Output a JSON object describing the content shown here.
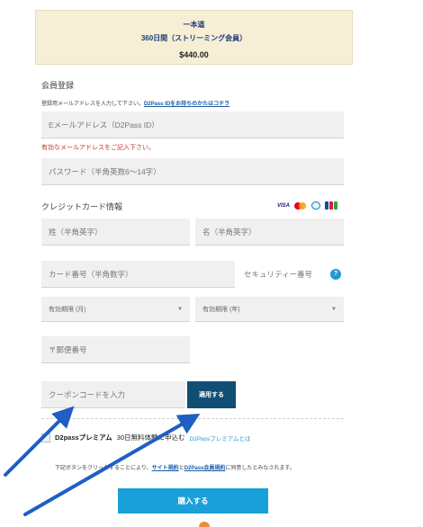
{
  "plan": {
    "name": "一本道",
    "duration": "360日間（ストリーミング会員）",
    "price": "$440.00"
  },
  "member": {
    "title": "会員登録",
    "note_prefix": "登録用メールアドレスを入力して下さい。",
    "note_link": "D2Pass IDをお持ちのかたはコチラ",
    "email_placeholder": "Eメールアドレス（D2Pass ID）",
    "email_error": "有効なメールアドレスをご記入下さい。",
    "password_placeholder": "パスワード（半角英数6～14字）"
  },
  "card": {
    "title": "クレジットカード情報",
    "brands": {
      "visa": "VISA"
    },
    "last_name_placeholder": "姓（半角英字）",
    "first_name_placeholder": "名（半角英字）",
    "number_placeholder": "カード番号（半角数字）",
    "security_label": "セキュリティー番号",
    "help_glyph": "?",
    "exp_month": "有効期限 (月)",
    "exp_year": "有効期限 (年)",
    "zip_placeholder": "〒郵便番号"
  },
  "coupon": {
    "placeholder": "クーポンコードを入力",
    "apply_label": "適用する"
  },
  "premium": {
    "name": "D2passプレミアム",
    "trial": "30日無料体験に申込む",
    "link": "D2Passプレミアムとは"
  },
  "terms": {
    "prefix": "下記ボタンをクリックすることにより、",
    "link1": "サイト規約",
    "mid": "と",
    "link2": "D2Pass会員規約",
    "suffix": "に同意したとみなされます。"
  },
  "buy_label": "購入する",
  "colors": {
    "primary_button": "#1aa0d8",
    "coupon_button": "#114e74",
    "arrow": "#1f5fc4",
    "plan_box": "#f6efd6"
  }
}
